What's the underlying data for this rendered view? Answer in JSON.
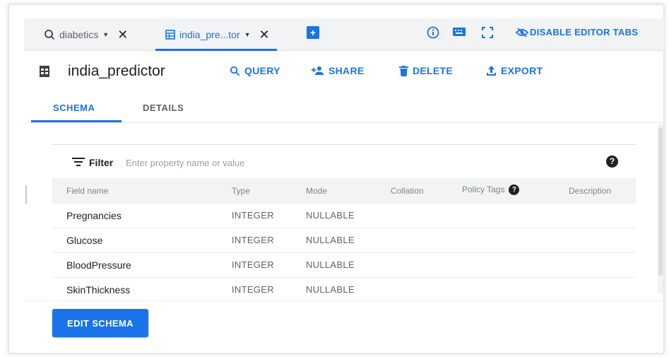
{
  "tabs": [
    {
      "icon": "search-icon",
      "label": "diabetics",
      "active": false
    },
    {
      "icon": "table-icon",
      "label": "india_pre...tor",
      "active": true
    }
  ],
  "toolbar": {
    "disable_editor_tabs": "DISABLE EDITOR TABS"
  },
  "header": {
    "title": "india_predictor",
    "actions": {
      "query": "QUERY",
      "share": "SHARE",
      "delete": "DELETE",
      "export": "EXPORT"
    }
  },
  "subtabs": {
    "schema": "SCHEMA",
    "details": "DETAILS"
  },
  "filter": {
    "label": "Filter",
    "placeholder": "Enter property name or value"
  },
  "table": {
    "headers": {
      "field_name": "Field name",
      "type": "Type",
      "mode": "Mode",
      "collation": "Collation",
      "policy_tags": "Policy Tags",
      "description": "Description"
    },
    "rows": [
      {
        "name": "Pregnancies",
        "type": "INTEGER",
        "mode": "NULLABLE"
      },
      {
        "name": "Glucose",
        "type": "INTEGER",
        "mode": "NULLABLE"
      },
      {
        "name": "BloodPressure",
        "type": "INTEGER",
        "mode": "NULLABLE"
      },
      {
        "name": "SkinThickness",
        "type": "INTEGER",
        "mode": "NULLABLE"
      }
    ]
  },
  "edit_schema_button": "EDIT SCHEMA",
  "colors": {
    "accent": "#1a73e8",
    "text": "#202124",
    "muted": "#5f6368"
  }
}
